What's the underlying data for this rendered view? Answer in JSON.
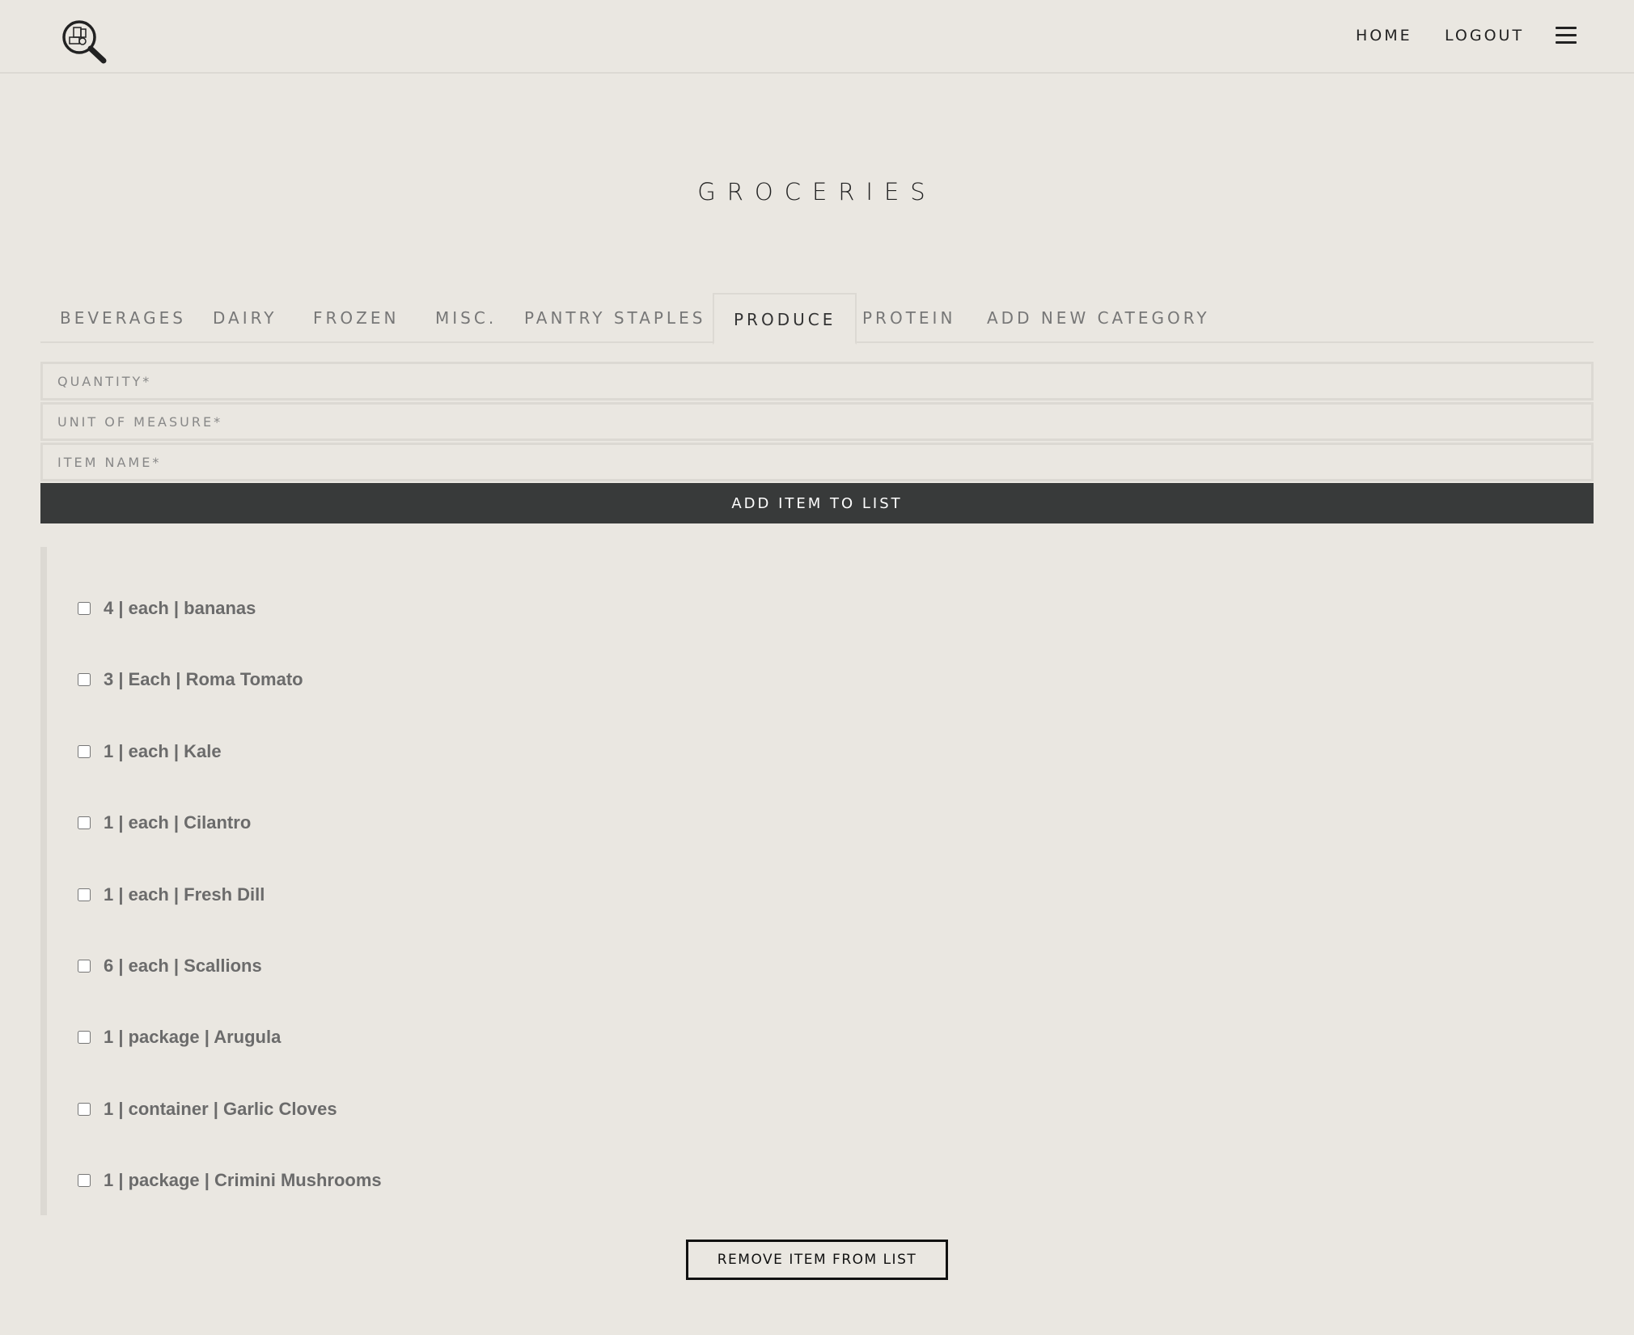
{
  "header": {
    "logo_icon": "magnifier-grocery-icon",
    "nav": [
      {
        "label": "HOME"
      },
      {
        "label": "LOGOUT"
      }
    ],
    "menu_icon": "hamburger-icon"
  },
  "page": {
    "title": "GROCERIES"
  },
  "tabs": [
    {
      "label": "BEVERAGES"
    },
    {
      "label": "DAIRY"
    },
    {
      "label": "FROZEN"
    },
    {
      "label": "MISC."
    },
    {
      "label": "PANTRY STAPLES"
    },
    {
      "label": "PRODUCE",
      "active": true
    },
    {
      "label": "PROTEIN"
    },
    {
      "label": "ADD NEW CATEGORY"
    }
  ],
  "form": {
    "quantity_placeholder": "QUANTITY*",
    "unit_placeholder": "UNIT OF MEASURE*",
    "item_placeholder": "ITEM NAME*",
    "add_button": "ADD ITEM TO LIST"
  },
  "items": [
    {
      "label": "4 | each | bananas",
      "checked": false
    },
    {
      "label": "3 | Each | Roma Tomato",
      "checked": false
    },
    {
      "label": "1 | each | Kale",
      "checked": false
    },
    {
      "label": "1 | each | Cilantro",
      "checked": false
    },
    {
      "label": "1 | each | Fresh Dill",
      "checked": false
    },
    {
      "label": "6 | each | Scallions",
      "checked": false
    },
    {
      "label": "1 | package | Arugula",
      "checked": false
    },
    {
      "label": "1 | container | Garlic Cloves",
      "checked": false
    },
    {
      "label": "1 | package | Crimini Mushrooms",
      "checked": false
    }
  ],
  "remove_button": "REMOVE ITEM FROM LIST",
  "colors": {
    "background": "#eae7e1",
    "dark_button": "#383a3a",
    "border": "#dcd9d3",
    "item_text": "#6b6b6b"
  }
}
